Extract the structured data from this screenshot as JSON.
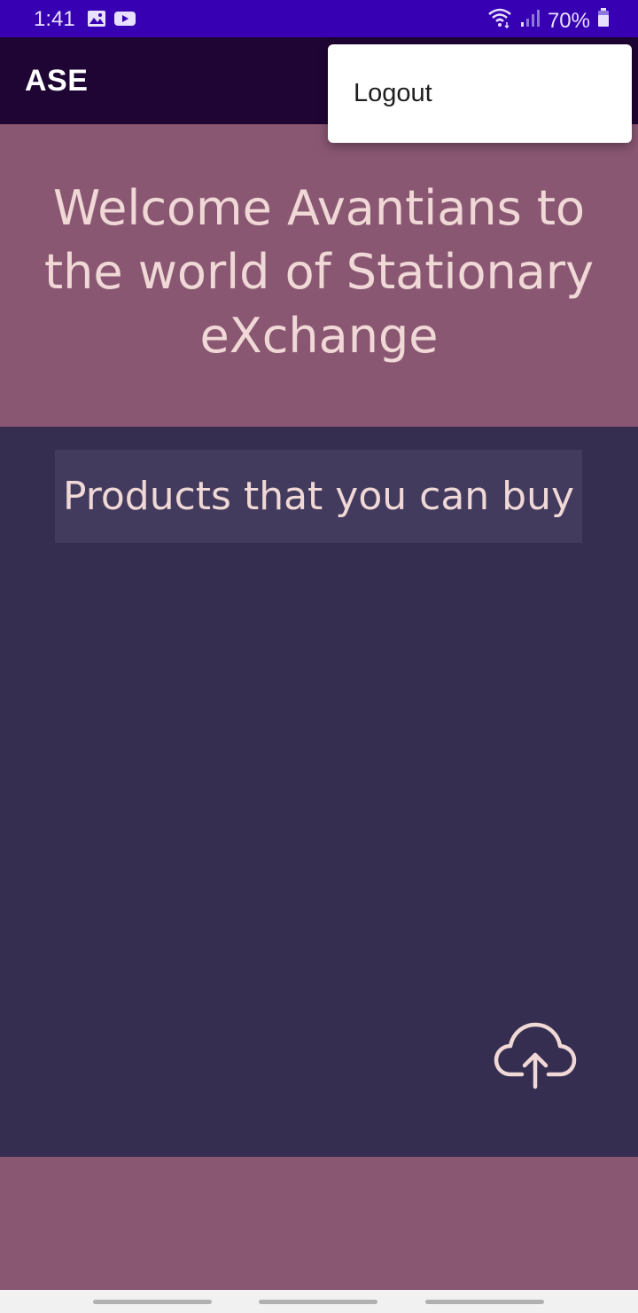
{
  "status_bar": {
    "time": "1:41",
    "left_icons": [
      "image-icon",
      "youtube-icon"
    ],
    "right_icons": [
      "wifi-icon",
      "signal-icon",
      "battery-icon"
    ],
    "battery": "70%"
  },
  "app_bar": {
    "title": "ASE"
  },
  "overflow_menu": {
    "items": [
      {
        "label": "Logout"
      }
    ]
  },
  "welcome": {
    "text": "Welcome Avantians to the world of Stationary eXchange"
  },
  "products": {
    "heading": "Products that you can buy",
    "upload_icon": "cloud-upload-icon"
  },
  "colors": {
    "status_bar": "#3700b3",
    "app_bar": "#1f0533",
    "panel_pink": "#8a5773",
    "panel_dark": "#362e50",
    "heading_box": "#433b5e",
    "text_light": "#f0d8d6"
  }
}
